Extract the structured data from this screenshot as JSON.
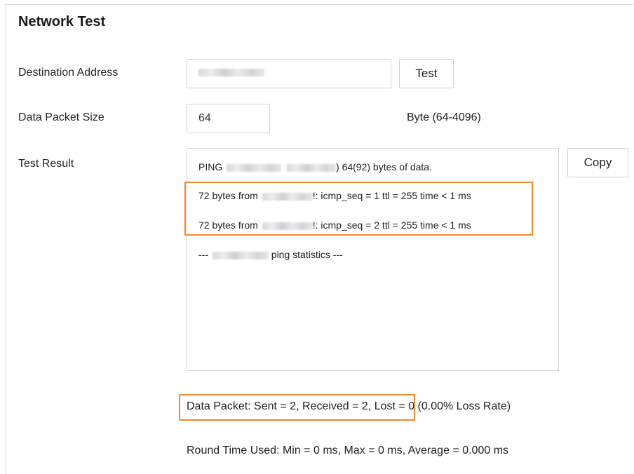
{
  "page": {
    "title": "Network Test"
  },
  "form": {
    "destination_label": "Destination Address",
    "test_button": "Test",
    "packet_size_label": "Data Packet Size",
    "packet_size_value": "64",
    "packet_size_hint": "Byte (64-4096)",
    "result_label": "Test Result",
    "copy_button": "Copy"
  },
  "result": {
    "line1_prefix": "PING",
    "line1_suffix": ") 64(92) bytes of data.",
    "reply1_prefix": "72 bytes from",
    "reply1_suffix": "!: icmp_seq = 1 ttl = 255 time < 1 ms",
    "reply2_prefix": "72 bytes from",
    "reply2_suffix": "!: icmp_seq = 2 ttl = 255 time < 1 ms",
    "stats_prefix": "---",
    "stats_suffix": "ping statistics ---"
  },
  "summary": {
    "packets_highlight": "Data Packet: Sent = 2, Received = 2,",
    "packets_rest": "Lost = 0 (0.00% Loss Rate)",
    "round_time": "Round Time Used: Min = 0 ms, Max = 0 ms, Average = 0.000 ms"
  },
  "colors": {
    "highlight": "#f08a2c"
  }
}
